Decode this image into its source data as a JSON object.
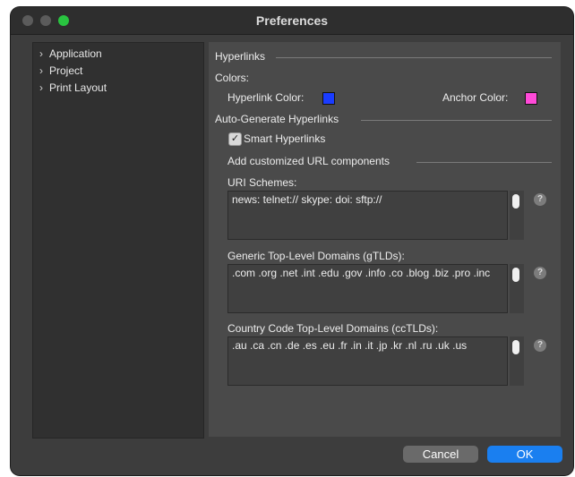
{
  "window": {
    "title": "Preferences"
  },
  "sidebar": {
    "items": [
      {
        "label": "Application"
      },
      {
        "label": "Project"
      },
      {
        "label": "Print Layout"
      }
    ]
  },
  "panel": {
    "hyperlinks_header": "Hyperlinks",
    "colors_label": "Colors:",
    "hyperlink_color_label": "Hyperlink Color:",
    "hyperlink_color": "#1a3cff",
    "anchor_color_label": "Anchor Color:",
    "anchor_color": "#ff4ad8",
    "auto_generate_header": "Auto-Generate Hyperlinks",
    "smart_hyperlinks_label": "Smart Hyperlinks",
    "smart_hyperlinks_checked": true,
    "custom_url_header": "Add customized URL components",
    "uri_schemes_label": "URI Schemes:",
    "uri_schemes_value": "news: telnet:// skype: doi: sftp://",
    "gtlds_label": "Generic Top-Level Domains (gTLDs):",
    "gtlds_value": ".com .org .net .int .edu .gov .info .co .blog .biz .pro .inc",
    "cctlds_label": "Country Code Top-Level Domains (ccTLDs):",
    "cctlds_value": ".au .ca .cn .de .es .eu .fr .in .it .jp .kr .nl .ru .uk .us",
    "help_glyph": "?"
  },
  "footer": {
    "cancel_label": "Cancel",
    "ok_label": "OK"
  }
}
